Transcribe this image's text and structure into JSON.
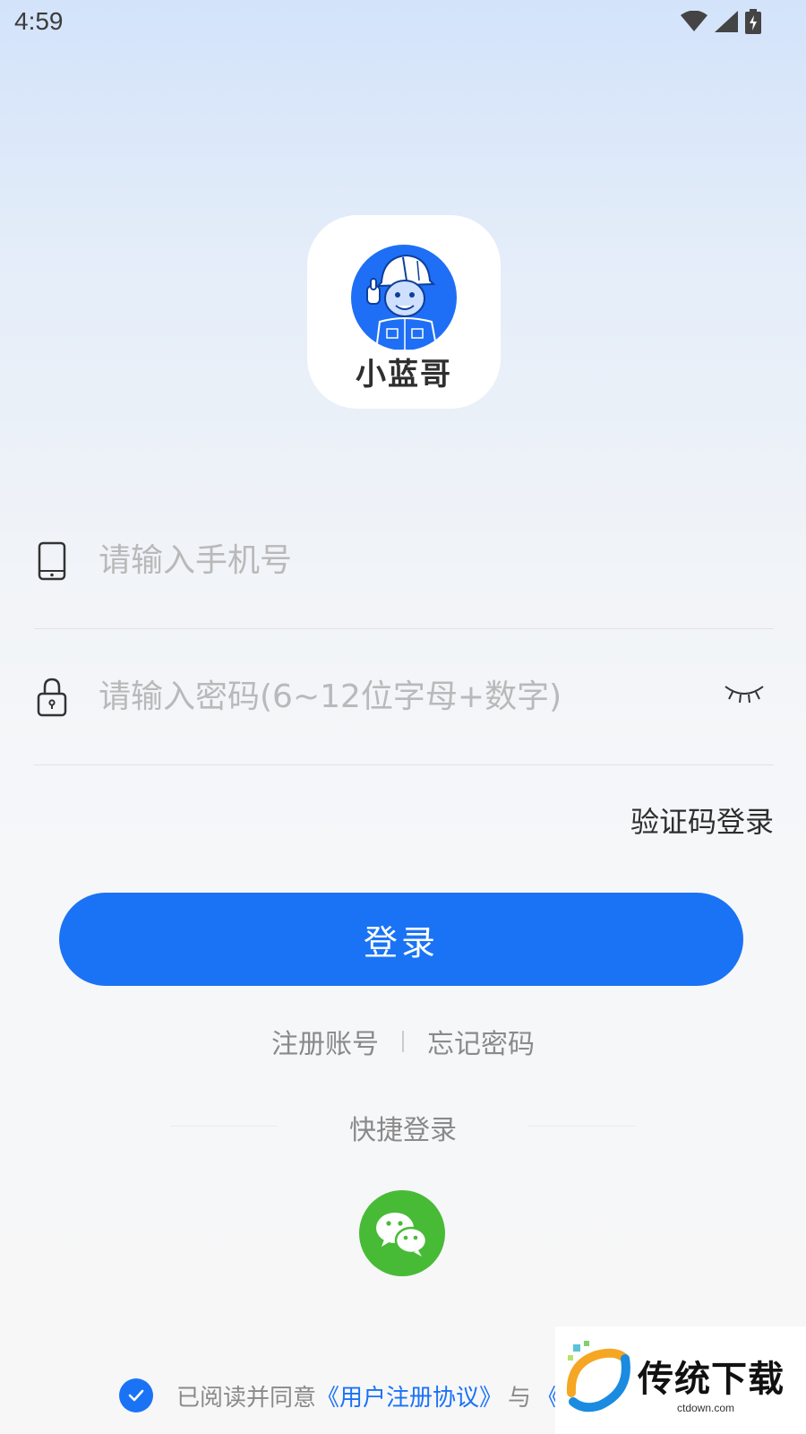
{
  "status_bar": {
    "time": "4:59",
    "icons": [
      "wifi-icon",
      "signal-icon",
      "battery-charging-icon"
    ]
  },
  "logo": {
    "app_name": "小蓝哥",
    "brand_color": "#1e6ff5"
  },
  "form": {
    "phone_placeholder": "请输入手机号",
    "password_placeholder": "请输入密码(6~12位字母+数字)",
    "code_login_label": "验证码登录",
    "login_button_label": "登录"
  },
  "links": {
    "register_label": "注册账号",
    "forgot_label": "忘记密码"
  },
  "quick_login": {
    "label": "快捷登录",
    "provider_icon": "wechat-icon",
    "provider_color": "#48bb36"
  },
  "agreement": {
    "checked": true,
    "prefix": "已阅读并同意",
    "user_agreement": "《用户注册协议》",
    "connector": "与",
    "privacy_partial": "《l"
  },
  "watermark": {
    "title": "传统下载",
    "subtitle": "ctdown.com"
  },
  "colors": {
    "accent": "#1a73f5",
    "wechat": "#48bb36",
    "text_muted": "#8a8a8a"
  }
}
